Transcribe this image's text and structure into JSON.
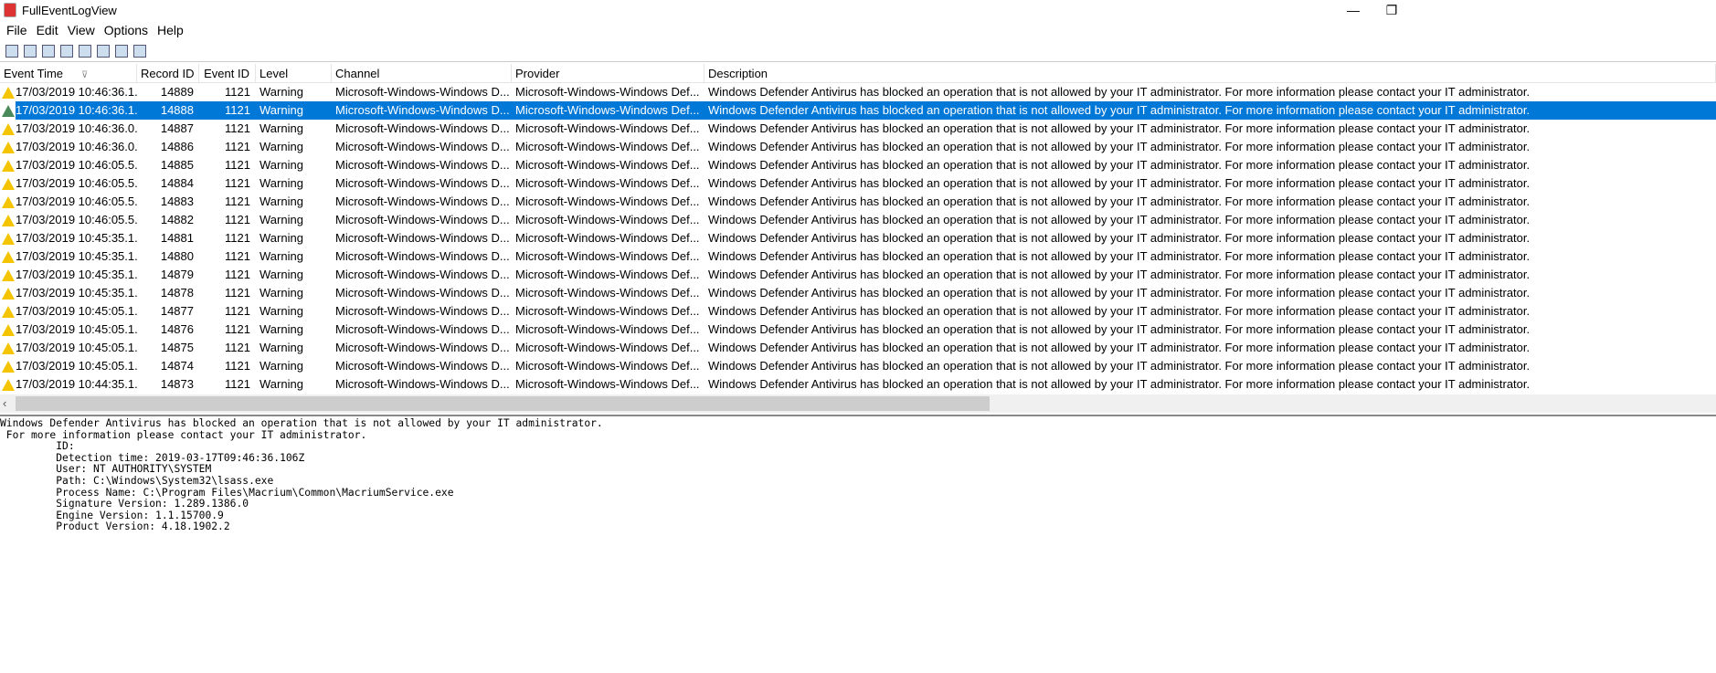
{
  "window": {
    "title": "FullEventLogView",
    "minimize": "—",
    "restore": "❐"
  },
  "menu": [
    "File",
    "Edit",
    "View",
    "Options",
    "Help"
  ],
  "toolbar": [
    "properties-icon",
    "event-sources-icon",
    "save-icon",
    "refresh-icon",
    "copy-icon",
    "options-icon",
    "find-icon",
    "exit-icon"
  ],
  "columns": [
    "Event Time",
    "Record ID",
    "Event ID",
    "Level",
    "Channel",
    "Provider",
    "Description"
  ],
  "sort_indicator": "⊽",
  "rows": [
    {
      "time": "17/03/2019 10:46:36.1...",
      "record": "14889"
    },
    {
      "time": "17/03/2019 10:46:36.1...",
      "record": "14888",
      "selected": true
    },
    {
      "time": "17/03/2019 10:46:36.0...",
      "record": "14887"
    },
    {
      "time": "17/03/2019 10:46:36.0...",
      "record": "14886"
    },
    {
      "time": "17/03/2019 10:46:05.5...",
      "record": "14885"
    },
    {
      "time": "17/03/2019 10:46:05.5...",
      "record": "14884"
    },
    {
      "time": "17/03/2019 10:46:05.5...",
      "record": "14883"
    },
    {
      "time": "17/03/2019 10:46:05.5...",
      "record": "14882"
    },
    {
      "time": "17/03/2019 10:45:35.1...",
      "record": "14881"
    },
    {
      "time": "17/03/2019 10:45:35.1...",
      "record": "14880"
    },
    {
      "time": "17/03/2019 10:45:35.1...",
      "record": "14879"
    },
    {
      "time": "17/03/2019 10:45:35.1...",
      "record": "14878"
    },
    {
      "time": "17/03/2019 10:45:05.1...",
      "record": "14877"
    },
    {
      "time": "17/03/2019 10:45:05.1...",
      "record": "14876"
    },
    {
      "time": "17/03/2019 10:45:05.1...",
      "record": "14875"
    },
    {
      "time": "17/03/2019 10:45:05.1...",
      "record": "14874"
    },
    {
      "time": "17/03/2019 10:44:35.1...",
      "record": "14873"
    }
  ],
  "row_common": {
    "event_id": "1121",
    "level": "Warning",
    "channel": "Microsoft-Windows-Windows D...",
    "provider": "Microsoft-Windows-Windows Def...",
    "description": "Windows Defender Antivirus has blocked an operation that is not allowed by your IT administrator. For more information please contact your IT administrator."
  },
  "scroll_left": "‹",
  "detail": "Windows Defender Antivirus has blocked an operation that is not allowed by your IT administrator.\n For more information please contact your IT administrator.\n \t ID: \n \t Detection time: 2019-03-17T09:46:36.106Z\n \t User: NT AUTHORITY\\SYSTEM\n \t Path: C:\\Windows\\System32\\lsass.exe\n \t Process Name: C:\\Program Files\\Macrium\\Common\\MacriumService.exe\n \t Signature Version: 1.289.1386.0\n \t Engine Version: 1.1.15700.9\n \t Product Version: 4.18.1902.2"
}
